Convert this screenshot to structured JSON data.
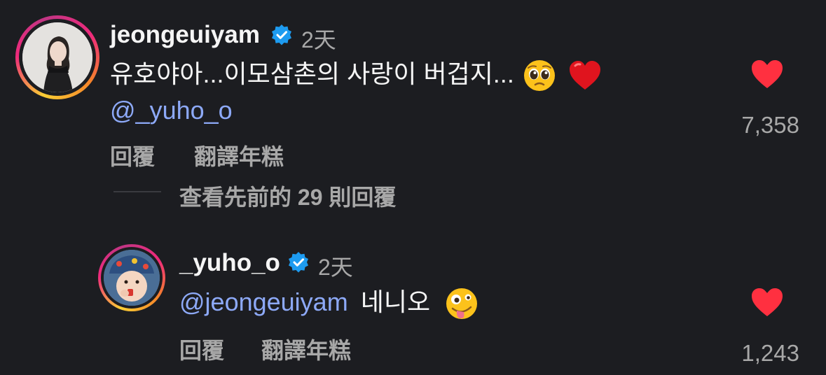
{
  "comment": {
    "username": "jeongeuiyam",
    "time": "2天",
    "text": "유호야아...이모삼촌의 사랑이 버겁지...",
    "emojis": [
      "pleading-face",
      "red-heart"
    ],
    "mention": "@_yuho_o",
    "reply_label": "回覆",
    "translate_label": "翻譯年糕",
    "like_count": "7,358"
  },
  "view_replies_label": "查看先前的 29 則回覆",
  "reply": {
    "username": "_yuho_o",
    "time": "2天",
    "mention": "@jeongeuiyam",
    "text": "네니오",
    "emojis": [
      "zany-face"
    ],
    "reply_label": "回覆",
    "translate_label": "翻譯年糕",
    "like_count": "1,243"
  },
  "colors": {
    "background": "#1c1d21",
    "mention": "#8da9f7",
    "heart": "#ff3040",
    "verified": "#1d9bf0",
    "muted_text": "#a8a8a8"
  }
}
